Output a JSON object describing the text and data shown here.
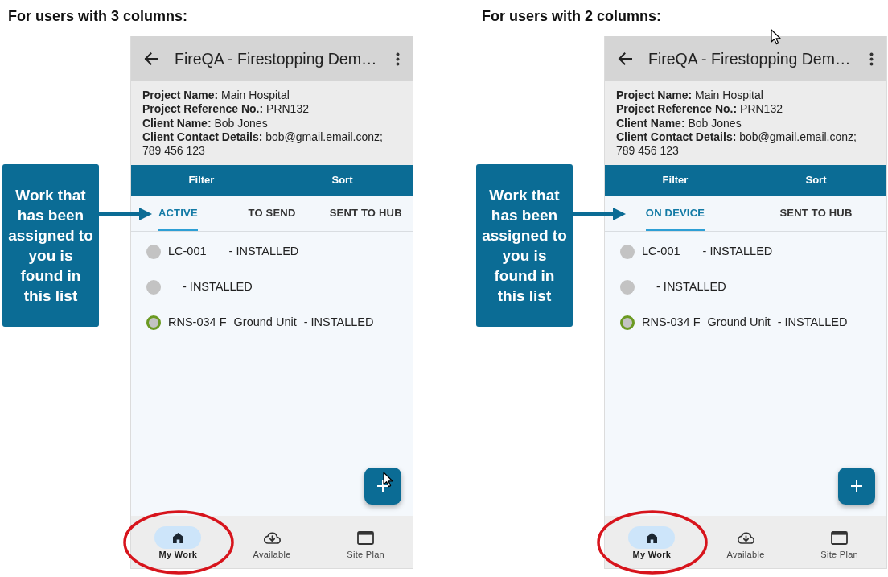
{
  "panels": [
    {
      "heading": "For users with 3 columns:",
      "callout": "Work that has been assigned to you is found in this list",
      "phone": {
        "app_bar": {
          "title": "FireQA - Firestopping Dem…",
          "pointer": false
        },
        "project_info": [
          {
            "label": "Project Name:",
            "value": "Main Hospital"
          },
          {
            "label": "Project Reference No.:",
            "value": "PRN132"
          },
          {
            "label": "Client Name:",
            "value": "Bob Jones"
          },
          {
            "label": "Client Contact Details:",
            "value": "bob@gmail.email.conz; 789 456 123"
          }
        ],
        "action_bar": [
          {
            "label": "Filter"
          },
          {
            "label": "Sort"
          }
        ],
        "tabs": [
          {
            "label": "ACTIVE",
            "selected": true
          },
          {
            "label": "TO SEND",
            "selected": false
          },
          {
            "label": "SENT TO HUB",
            "selected": false
          }
        ],
        "items": [
          {
            "code": "LC-001",
            "status": "- INSTALLED",
            "ringed": false
          },
          {
            "status": "- INSTALLED",
            "ringed": false
          },
          {
            "code": "RNS-034 F",
            "name": "Ground Unit",
            "status": "- INSTALLED",
            "ringed": true
          }
        ],
        "fab": {
          "pointer": true
        },
        "bottom_nav": [
          {
            "kind": "home",
            "label": "My Work",
            "selected": true,
            "circled": true
          },
          {
            "kind": "cloud",
            "label": "Available",
            "selected": false,
            "circled": false
          },
          {
            "kind": "plan",
            "label": "Site Plan",
            "selected": false,
            "circled": false
          }
        ]
      }
    },
    {
      "heading": "For users with 2 columns:",
      "callout": "Work that has been assigned to you is found in this list",
      "phone": {
        "app_bar": {
          "title": "FireQA - Firestopping Dem…",
          "pointer": true
        },
        "project_info": [
          {
            "label": "Project Name:",
            "value": "Main Hospital"
          },
          {
            "label": "Project Reference No.:",
            "value": "PRN132"
          },
          {
            "label": "Client Name:",
            "value": "Bob Jones"
          },
          {
            "label": "Client Contact Details:",
            "value": "bob@gmail.email.conz; 789 456 123"
          }
        ],
        "action_bar": [
          {
            "label": "Filter"
          },
          {
            "label": "Sort"
          }
        ],
        "tabs": [
          {
            "label": "ON DEVICE",
            "selected": true
          },
          {
            "label": "SENT TO HUB",
            "selected": false
          }
        ],
        "items": [
          {
            "code": "LC-001",
            "status": "- INSTALLED",
            "ringed": false
          },
          {
            "status": "- INSTALLED",
            "ringed": false
          },
          {
            "code": "RNS-034 F",
            "name": "Ground Unit",
            "status": "- INSTALLED",
            "ringed": true
          }
        ],
        "fab": {
          "pointer": false
        },
        "bottom_nav": [
          {
            "kind": "home",
            "label": "My Work",
            "selected": true,
            "circled": true
          },
          {
            "kind": "cloud",
            "label": "Available",
            "selected": false,
            "circled": false
          },
          {
            "kind": "plan",
            "label": "Site Plan",
            "selected": false,
            "circled": false
          }
        ]
      }
    }
  ]
}
